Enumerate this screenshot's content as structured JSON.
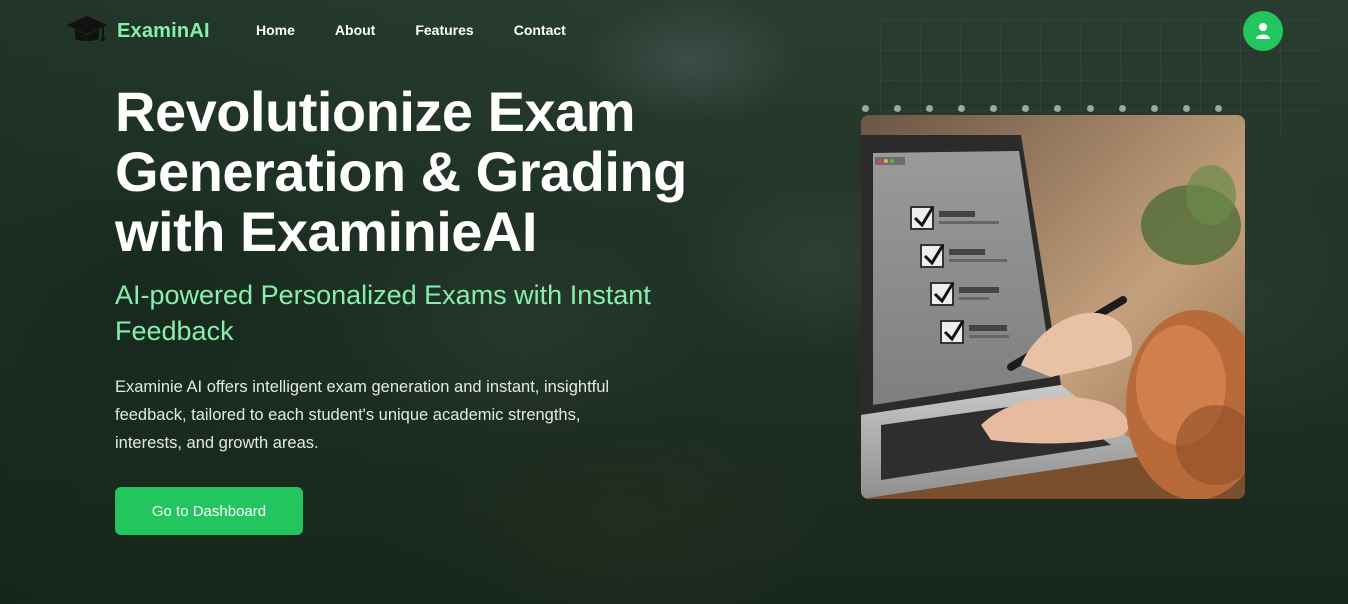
{
  "nav": {
    "logo_text": "ExaminAI",
    "links": [
      "Home",
      "About",
      "Features",
      "Contact"
    ]
  },
  "hero": {
    "title_lines": [
      "Revolutionize Exam",
      "Generation & Grading",
      "with ExaminieAI"
    ],
    "subtitle": "AI-powered Personalized Exams with Instant Feedback",
    "description": "Examinie AI offers intelligent exam generation and instant, insightful feedback, tailored to each student's unique academic strengths, interests, and growth areas.",
    "cta_label": "Go to Dashboard"
  },
  "colors": {
    "accent": "#22c55e",
    "logo_text": "#86efac",
    "subtitle": "#86efac"
  },
  "icons": [
    "graduation-cap-icon",
    "user-icon"
  ]
}
